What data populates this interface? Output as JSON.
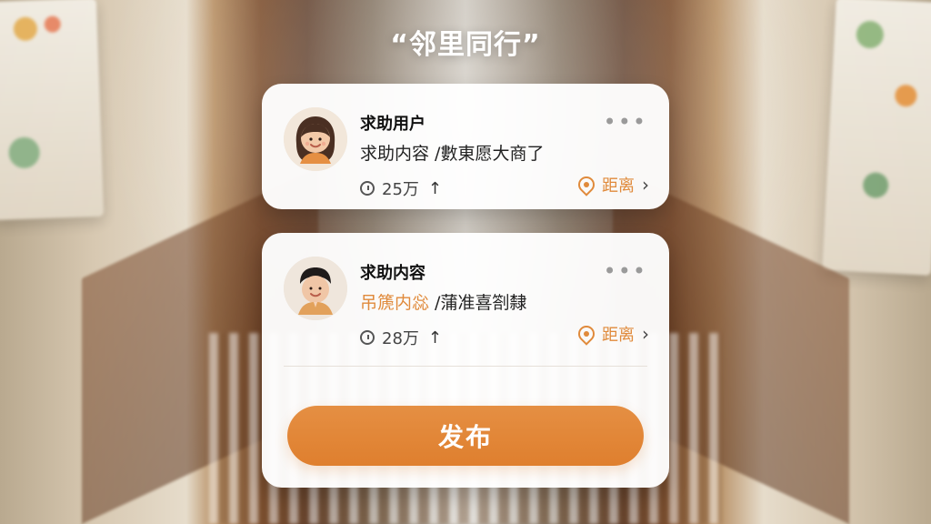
{
  "title": "“邻里同行”",
  "cards": [
    {
      "name": "求助用户",
      "content_segments": [
        {
          "text": "求助内容 /數東愿大商了",
          "style": "normal"
        }
      ],
      "meta_value": "25万",
      "distance_label": "距离"
    },
    {
      "name": "求助内容",
      "content_segments": [
        {
          "text": "吊篪内惢",
          "style": "accent"
        },
        {
          "text": " /蒲准喜劄隸",
          "style": "normal"
        }
      ],
      "meta_value": "28万",
      "distance_label": "距离"
    }
  ],
  "button": {
    "publish_label": "发布"
  },
  "colors": {
    "accent": "#e08a3b",
    "button": "#e58f43",
    "card_bg": "#ffffff"
  },
  "icons": {
    "more": "more-dots-icon",
    "time": "clock-icon",
    "up": "up-arrow-icon",
    "distance": "location-heart-icon",
    "chevron": "chevron-right-icon"
  }
}
